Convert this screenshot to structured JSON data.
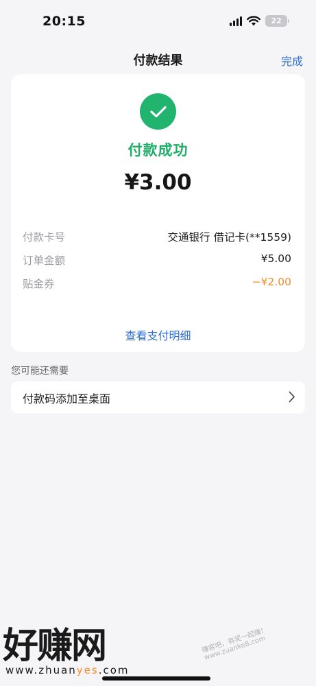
{
  "status_bar": {
    "time": "20:15",
    "battery_level": "22",
    "icons": [
      "signal-icon",
      "wifi-icon",
      "battery-icon"
    ]
  },
  "nav": {
    "title": "付款结果",
    "done_label": "完成"
  },
  "result": {
    "icon": "check-circle-icon",
    "status_text": "付款成功",
    "amount": "¥3.00",
    "details": [
      {
        "label": "付款卡号",
        "value": "交通银行 借记卡(**1559)"
      },
      {
        "label": "订单金额",
        "value": "¥5.00"
      },
      {
        "label": "贴金券",
        "value": "−¥2.00"
      }
    ],
    "detail_link": "查看支付明细"
  },
  "suggestions": {
    "title": "您可能还需要",
    "items": [
      {
        "label": "付款码添加至桌面",
        "icon": "chevron-right-icon"
      }
    ]
  },
  "watermark": {
    "logo": "好赚网",
    "url_prefix": "www.zhuan",
    "url_accent": "yes",
    "url_suffix": ".com",
    "slogan": "赚客吧，有奖一起赚！www.zuanke8.com"
  },
  "colors": {
    "success": "#21b46e",
    "link": "#2e6fd1",
    "discount": "#f08a2c",
    "background": "#f5f5f7"
  }
}
